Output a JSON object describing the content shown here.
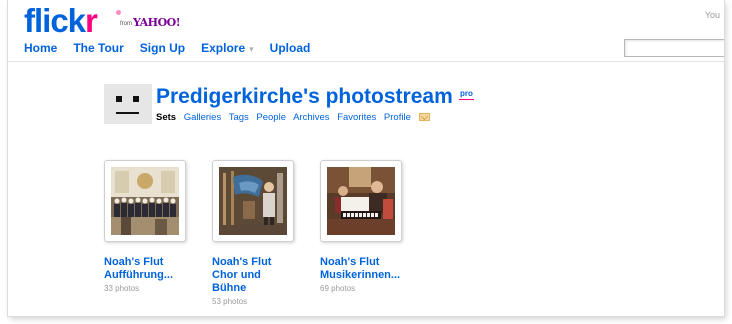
{
  "header": {
    "logo_main": "flick",
    "logo_r": "r",
    "logo_from": "from",
    "logo_yahoo": "YAHOO!",
    "top_right_text": "You",
    "nav": {
      "home": "Home",
      "tour": "The Tour",
      "signup": "Sign Up",
      "explore": "Explore",
      "upload": "Upload"
    },
    "search_value": ""
  },
  "profile": {
    "title": "Predigerkirche's photostream",
    "badge": "pro",
    "tabs": {
      "sets": "Sets",
      "galleries": "Galleries",
      "tags": "Tags",
      "people": "People",
      "archives": "Archives",
      "favorites": "Favorites",
      "profile": "Profile"
    }
  },
  "sets": [
    {
      "title_line1": "Noah's Flut",
      "title_line2": "Aufführung...",
      "title_line3": "",
      "count": "33 photos"
    },
    {
      "title_line1": "Noah's Flut",
      "title_line2": "Chor und",
      "title_line3": "Bühne",
      "count": "53 photos"
    },
    {
      "title_line1": "Noah's Flut",
      "title_line2": "Musikerinnen...",
      "title_line3": "",
      "count": "69 photos"
    }
  ],
  "colors": {
    "flickr_blue": "#0063dc",
    "flickr_pink": "#ff0084",
    "yahoo_purple": "#7b0099"
  }
}
